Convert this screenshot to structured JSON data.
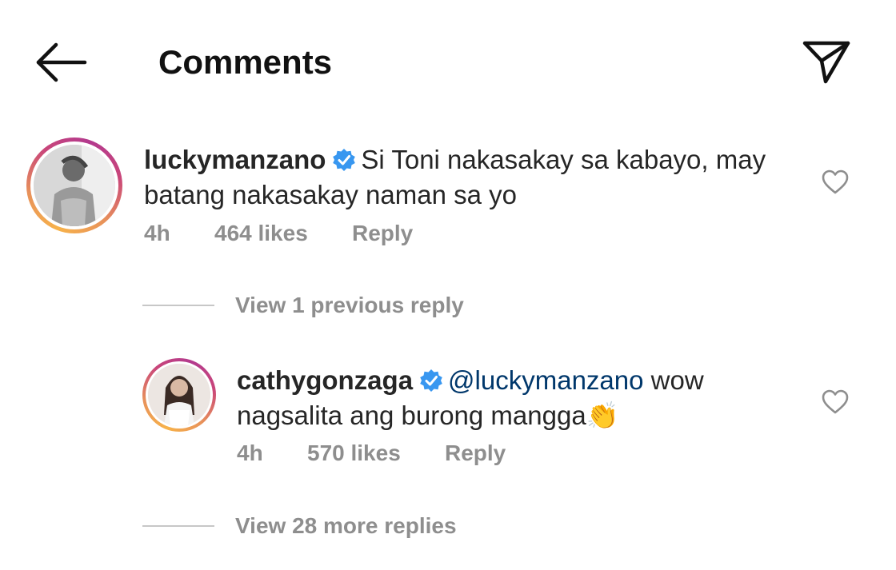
{
  "header": {
    "title": "Comments",
    "back_icon": "arrow-left-icon",
    "share_icon": "paper-plane-icon"
  },
  "comments": [
    {
      "username": "luckymanzano",
      "verified": true,
      "text_line1": "Si Toni nakasakay sa kabayo, may",
      "text_line2": "batang nakasakay naman sa yo",
      "time": "4h",
      "likes": "464 likes",
      "reply": "Reply",
      "view_replies": "View 1 previous reply"
    },
    {
      "username": "cathygonzaga",
      "verified": true,
      "mention": "@luckymanzano",
      "text_after_mention": " wow",
      "text_line2": "nagsalita ang burong mangga",
      "emoji": "👏",
      "time": "4h",
      "likes": "570 likes",
      "reply": "Reply",
      "view_replies": "View 28 more replies"
    }
  ],
  "colors": {
    "verified_blue": "#3897f0",
    "meta_gray": "#8e8e8e",
    "mention_blue": "#00376b"
  }
}
